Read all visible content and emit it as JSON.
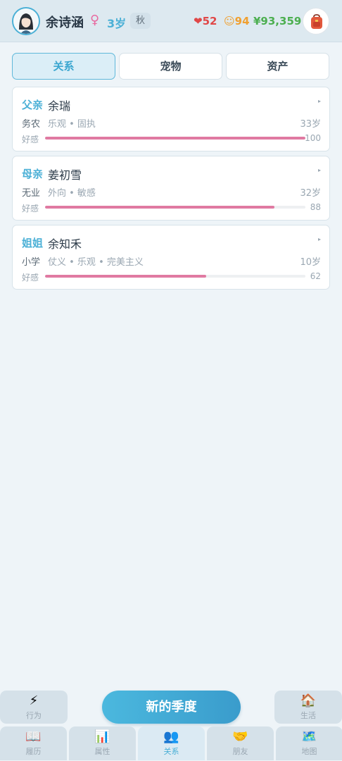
{
  "header": {
    "name": "余诗涵",
    "gender_symbol": "♀",
    "age": "3岁",
    "season": "秋",
    "health": "52",
    "mood": "94",
    "money": "¥93,359",
    "health_icon": "heart-icon",
    "mood_icon": "smile-icon",
    "bag_icon": "backpack-icon"
  },
  "tabs": [
    {
      "label": "关系",
      "active": true
    },
    {
      "label": "宠物",
      "active": false
    },
    {
      "label": "资产",
      "active": false
    }
  ],
  "relations": [
    {
      "relation": "父亲",
      "name": "余瑞",
      "job": "务农",
      "traits": "乐观 • 固执",
      "age": "33岁",
      "favor_label": "好感",
      "favor": 100,
      "arrow": "▸"
    },
    {
      "relation": "母亲",
      "name": "姜初雪",
      "job": "无业",
      "traits": "外向 • 敏感",
      "age": "32岁",
      "favor_label": "好感",
      "favor": 88,
      "arrow": "▸"
    },
    {
      "relation": "姐姐",
      "name": "余知禾",
      "job": "小学",
      "traits": "仗义 • 乐观 • 完美主义",
      "age": "10岁",
      "favor_label": "好感",
      "favor": 62,
      "arrow": "▸"
    }
  ],
  "actions": {
    "left": {
      "label": "行为",
      "icon": "⚡"
    },
    "center": {
      "label": "新的季度"
    },
    "right": {
      "label": "生活",
      "icon": "🏠"
    }
  },
  "nav": [
    {
      "label": "履历",
      "icon": "📖",
      "active": false
    },
    {
      "label": "属性",
      "icon": "📊",
      "active": false
    },
    {
      "label": "关系",
      "icon": "👥",
      "active": true
    },
    {
      "label": "朋友",
      "icon": "🤝",
      "active": false
    },
    {
      "label": "地图",
      "icon": "🗺️",
      "active": false
    }
  ],
  "colors": {
    "accent": "#4bb0d6",
    "favor_bar": "#e07aa2",
    "health": "#e04848",
    "mood": "#f0a030",
    "money": "#4caf50"
  }
}
